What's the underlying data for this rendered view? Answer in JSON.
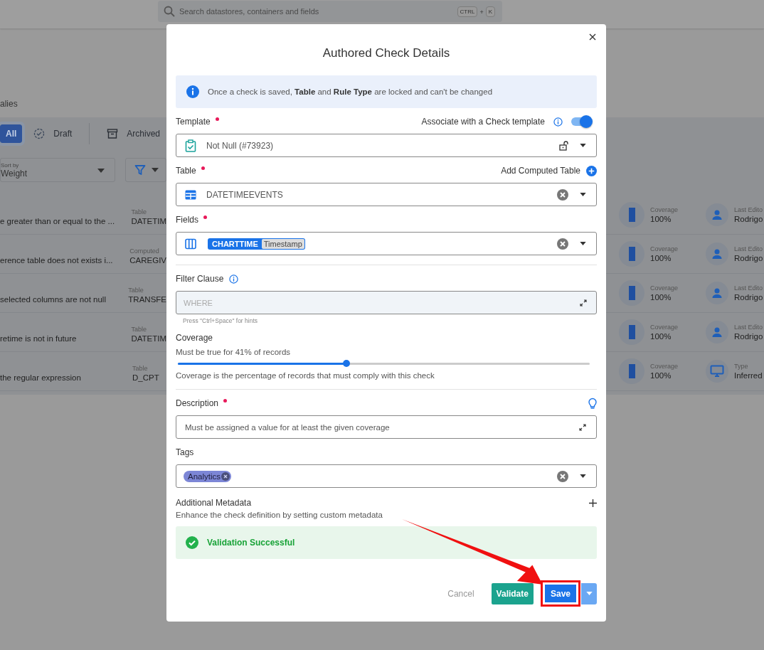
{
  "search": {
    "placeholder": "Search datastores, containers and fields",
    "shortcut": [
      "CTRL",
      "+",
      "K"
    ]
  },
  "page_heading": "alies",
  "status_tabs": [
    {
      "label": "All",
      "selected": true,
      "kind": "plain"
    },
    {
      "label": "Draft",
      "selected": false,
      "kind": "draft"
    },
    {
      "label": "Archived",
      "selected": false,
      "kind": "archived"
    }
  ],
  "sort": {
    "label": "Sort by",
    "value": "Weight"
  },
  "checks": [
    {
      "description": "e greater than or equal to the ...",
      "table_label": "Table",
      "table": "DATETIM",
      "coverage_label": "Coverage",
      "coverage": "100%",
      "kind": "editor",
      "meta_label": "Last Edito",
      "meta_value": "Rodrigo"
    },
    {
      "description": "erence table does not exists i...",
      "table_label": "Computed",
      "table": "CAREGIV",
      "coverage_label": "Coverage",
      "coverage": "100%",
      "kind": "editor",
      "meta_label": "Last Edito",
      "meta_value": "Rodrigo"
    },
    {
      "description": "selected columns are not null",
      "table_label": "Table",
      "table": "TRANSFE",
      "coverage_label": "Coverage",
      "coverage": "100%",
      "kind": "editor",
      "meta_label": "Last Edito",
      "meta_value": "Rodrigo"
    },
    {
      "description": "retime is not in future",
      "table_label": "Table",
      "table": "DATETIM",
      "coverage_label": "Coverage",
      "coverage": "100%",
      "kind": "editor",
      "meta_label": "Last Edito",
      "meta_value": "Rodrigo"
    },
    {
      "description": "the regular expression",
      "table_label": "Table",
      "table": "D_CPT",
      "coverage_label": "Coverage",
      "coverage": "100%",
      "kind": "type",
      "meta_label": "Type",
      "meta_value": "Inferred"
    }
  ],
  "dialog": {
    "title": "Authored Check Details",
    "notice": "Once a check is saved, **Table** and **Rule Type** are locked and can't be changed",
    "template": {
      "label": "Template",
      "required": true,
      "associate_label": "Associate with a Check template",
      "associate_on": true,
      "value": "Not Null (#73923)"
    },
    "table": {
      "label": "Table",
      "required": true,
      "add_label": "Add Computed Table",
      "value": "DATETIMEEVENTS"
    },
    "fields": {
      "label": "Fields",
      "required": true,
      "chips": [
        {
          "name": "CHARTTIME",
          "type": "Timestamp"
        }
      ]
    },
    "filter": {
      "label": "Filter Clause",
      "required": false,
      "placeholder": "WHERE",
      "hint": "Press \"Ctrl+Space\" for hints"
    },
    "coverage": {
      "label": "Coverage",
      "required": false,
      "reading": "Must be true for 41% of records",
      "level": 0.41,
      "note": "Coverage is the percentage of records that must comply with this check"
    },
    "description": {
      "label": "Description",
      "required": true,
      "value": "Must be assigned a value for at least the given coverage"
    },
    "tags": {
      "label": "Tags",
      "required": false,
      "items": [
        "Analytics"
      ]
    },
    "metadata": {
      "label": "Additional Metadata",
      "note": "Enhance the check definition by setting custom metadata"
    },
    "validation": {
      "success": true,
      "message": "Validation Successful"
    },
    "buttons": {
      "cancel": "Cancel",
      "validate": "Validate",
      "save": "Save"
    }
  }
}
